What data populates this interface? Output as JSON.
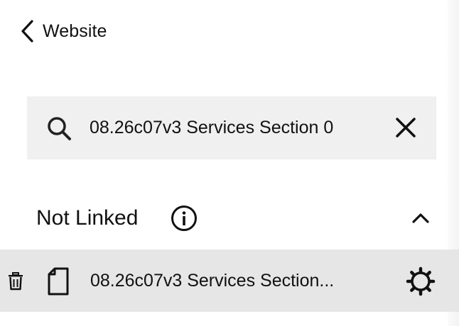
{
  "header": {
    "back_label": "Website"
  },
  "search": {
    "value": "08.26c07v3 Services Section 0",
    "placeholder": "",
    "icon": "search-icon",
    "clear_icon": "close-icon"
  },
  "section": {
    "title": "Not Linked",
    "info_icon": "info-icon",
    "collapse_icon": "chevron-up-icon"
  },
  "results": [
    {
      "title": "08.26c07v3 Services Section...",
      "icons": [
        "trash-icon",
        "page-icon",
        "gear-icon"
      ]
    }
  ]
}
